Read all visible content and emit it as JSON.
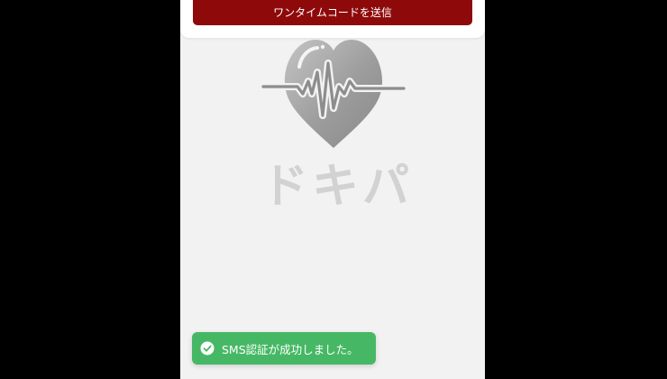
{
  "top_card": {
    "send_button_label": "ワンタイムコードを送信"
  },
  "logo": {
    "icon": "heart-pulse-icon",
    "text": "ドキパ"
  },
  "toast": {
    "icon": "check-circle-icon",
    "message": "SMS認証が成功しました。"
  },
  "colors": {
    "background": "#000000",
    "screen": "#f2f2f2",
    "button": "#8e0a0a",
    "toast": "#46b865",
    "logo_gray": "#a8a8a8"
  }
}
